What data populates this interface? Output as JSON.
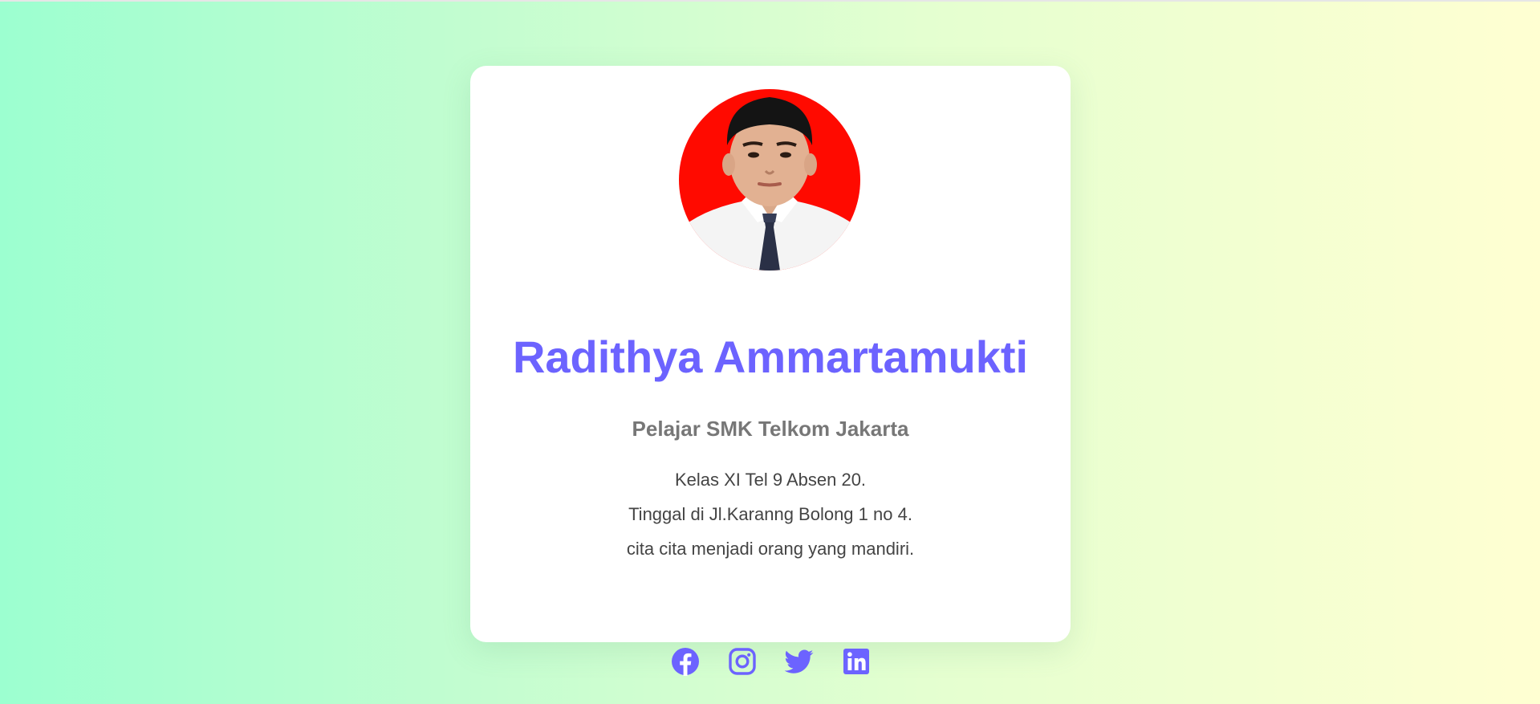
{
  "profile": {
    "name": "Radithya Ammartamukti",
    "role": "Pelajar SMK Telkom Jakarta",
    "description": [
      "Kelas XI Tel 9 Absen 20.",
      "Tinggal di Jl.Karanng Bolong 1 no 4.",
      "cita cita menjadi orang yang mandiri."
    ],
    "photo_icon": "profile-photo"
  },
  "socials": [
    {
      "name": "facebook",
      "icon": "facebook-icon"
    },
    {
      "name": "instagram",
      "icon": "instagram-icon"
    },
    {
      "name": "twitter",
      "icon": "twitter-icon"
    },
    {
      "name": "linkedin",
      "icon": "linkedin-icon"
    }
  ],
  "colors": {
    "accent": "#6c63ff",
    "role_text": "#777777",
    "body_text": "#444444",
    "card_bg": "#ffffff",
    "photo_bg": "#ff0a00",
    "gradient_start": "#9cffd0",
    "gradient_end": "#ffffd2"
  }
}
